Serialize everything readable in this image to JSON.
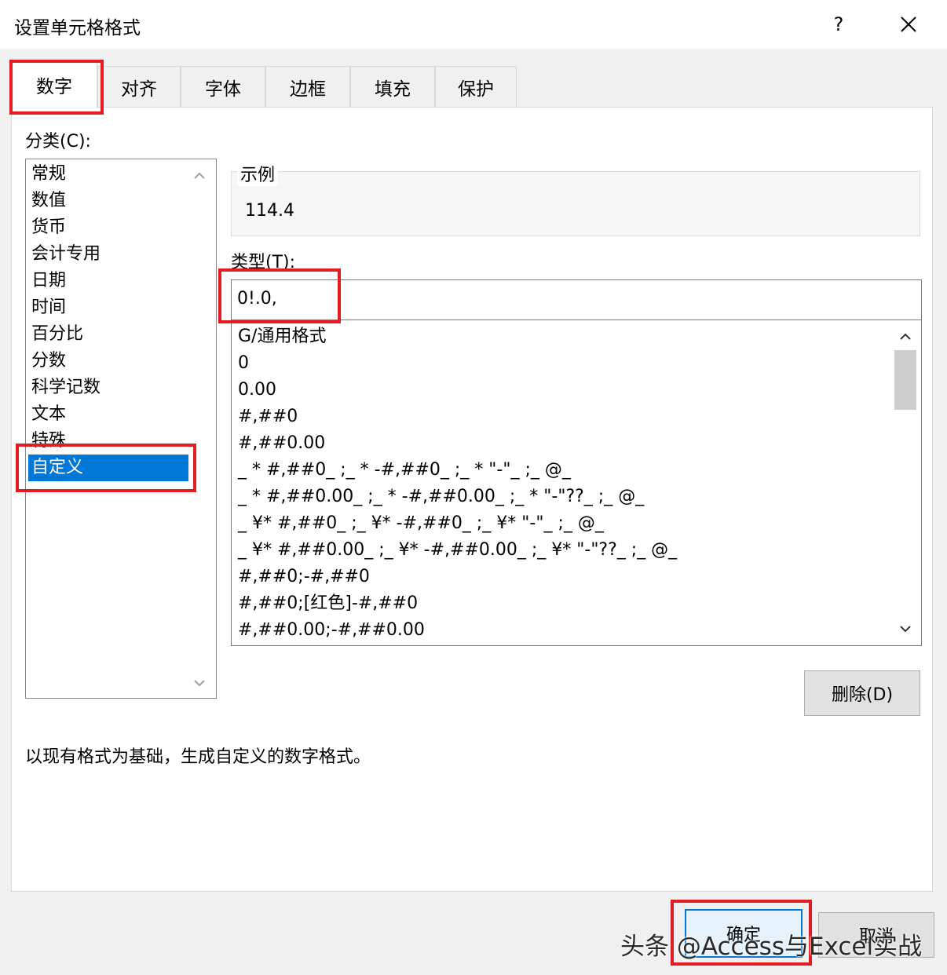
{
  "dialog": {
    "title": "设置单元格格式",
    "help_label": "?",
    "close_icon": "close-icon"
  },
  "tabs": [
    {
      "label": "数字",
      "active": true
    },
    {
      "label": "对齐",
      "active": false
    },
    {
      "label": "字体",
      "active": false
    },
    {
      "label": "边框",
      "active": false
    },
    {
      "label": "填充",
      "active": false
    },
    {
      "label": "保护",
      "active": false
    }
  ],
  "category": {
    "label": "分类(C):",
    "items": [
      "常规",
      "数值",
      "货币",
      "会计专用",
      "日期",
      "时间",
      "百分比",
      "分数",
      "科学记数",
      "文本",
      "特殊",
      "自定义"
    ],
    "selected": "自定义"
  },
  "sample": {
    "label": "示例",
    "value": "114.4"
  },
  "type": {
    "label": "类型(T):",
    "value": "0!.0,"
  },
  "format_list": {
    "items": [
      "G/通用格式",
      "0",
      "0.00",
      "#,##0",
      "#,##0.00",
      "_ * #,##0_ ;_ * -#,##0_ ;_ * \"-\"_ ;_ @_",
      "_ * #,##0.00_ ;_ * -#,##0.00_ ;_ * \"-\"??_ ;_ @_",
      "_ ¥* #,##0_ ;_ ¥* -#,##0_ ;_ ¥* \"-\"_ ;_ @_",
      "_ ¥* #,##0.00_ ;_ ¥* -#,##0.00_ ;_ ¥* \"-\"??_ ;_ @_",
      "#,##0;-#,##0",
      "#,##0;[红色]-#,##0",
      "#,##0.00;-#,##0.00"
    ]
  },
  "buttons": {
    "delete": "删除(D)",
    "ok": "确定",
    "cancel": "取消"
  },
  "description": "以现有格式为基础，生成自定义的数字格式。",
  "watermark": "头条 @Access与Excel实战",
  "colors": {
    "highlight_box": "#e31b23",
    "selection": "#0078d7"
  }
}
